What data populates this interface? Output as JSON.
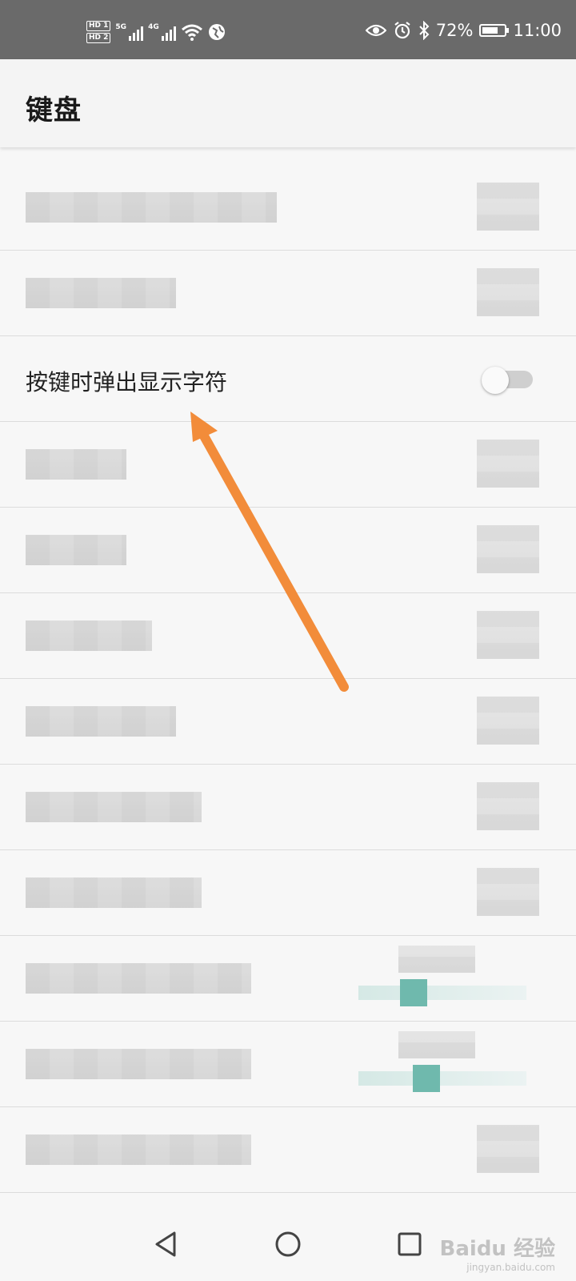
{
  "status_bar": {
    "hd1": "HD 1",
    "hd2": "HD 2",
    "net1": "5G",
    "net2": "4G",
    "battery_text": "72%",
    "battery_level": 0.72,
    "time": "11:00",
    "icons": [
      "hd-icon",
      "signal-5g-icon",
      "signal-4g-icon",
      "wifi-icon",
      "vpn-globe-icon",
      "eye-icon",
      "alarm-icon",
      "bluetooth-icon",
      "battery-icon"
    ]
  },
  "appbar": {
    "title": "键盘"
  },
  "rows": [
    {
      "label": "",
      "blurred": true
    },
    {
      "label": "",
      "blurred": true
    },
    {
      "label": "按键时弹出显示字符",
      "toggle": false
    },
    {
      "label": "",
      "blurred": true
    },
    {
      "label": "",
      "blurred": true
    },
    {
      "label": "",
      "blurred": true
    },
    {
      "label": "",
      "blurred": true
    },
    {
      "label": "",
      "blurred": true
    },
    {
      "label": "",
      "blurred": true
    },
    {
      "label": "",
      "blurred": true,
      "slider": true
    },
    {
      "label": "",
      "blurred": true,
      "slider": true
    },
    {
      "label": "",
      "blurred": true
    }
  ],
  "annotation": {
    "color": "#f28c3a",
    "icon": "arrow-annotation-icon"
  },
  "navbar": {
    "icons": [
      "back-icon",
      "home-icon",
      "recents-icon"
    ]
  },
  "watermark": {
    "text": "Baidu 经验",
    "sub": "jingyan.baidu.com"
  },
  "colors": {
    "status_bar": "#6a6a6a",
    "background": "#f7f7f7",
    "accent": "#6fb9ad"
  }
}
